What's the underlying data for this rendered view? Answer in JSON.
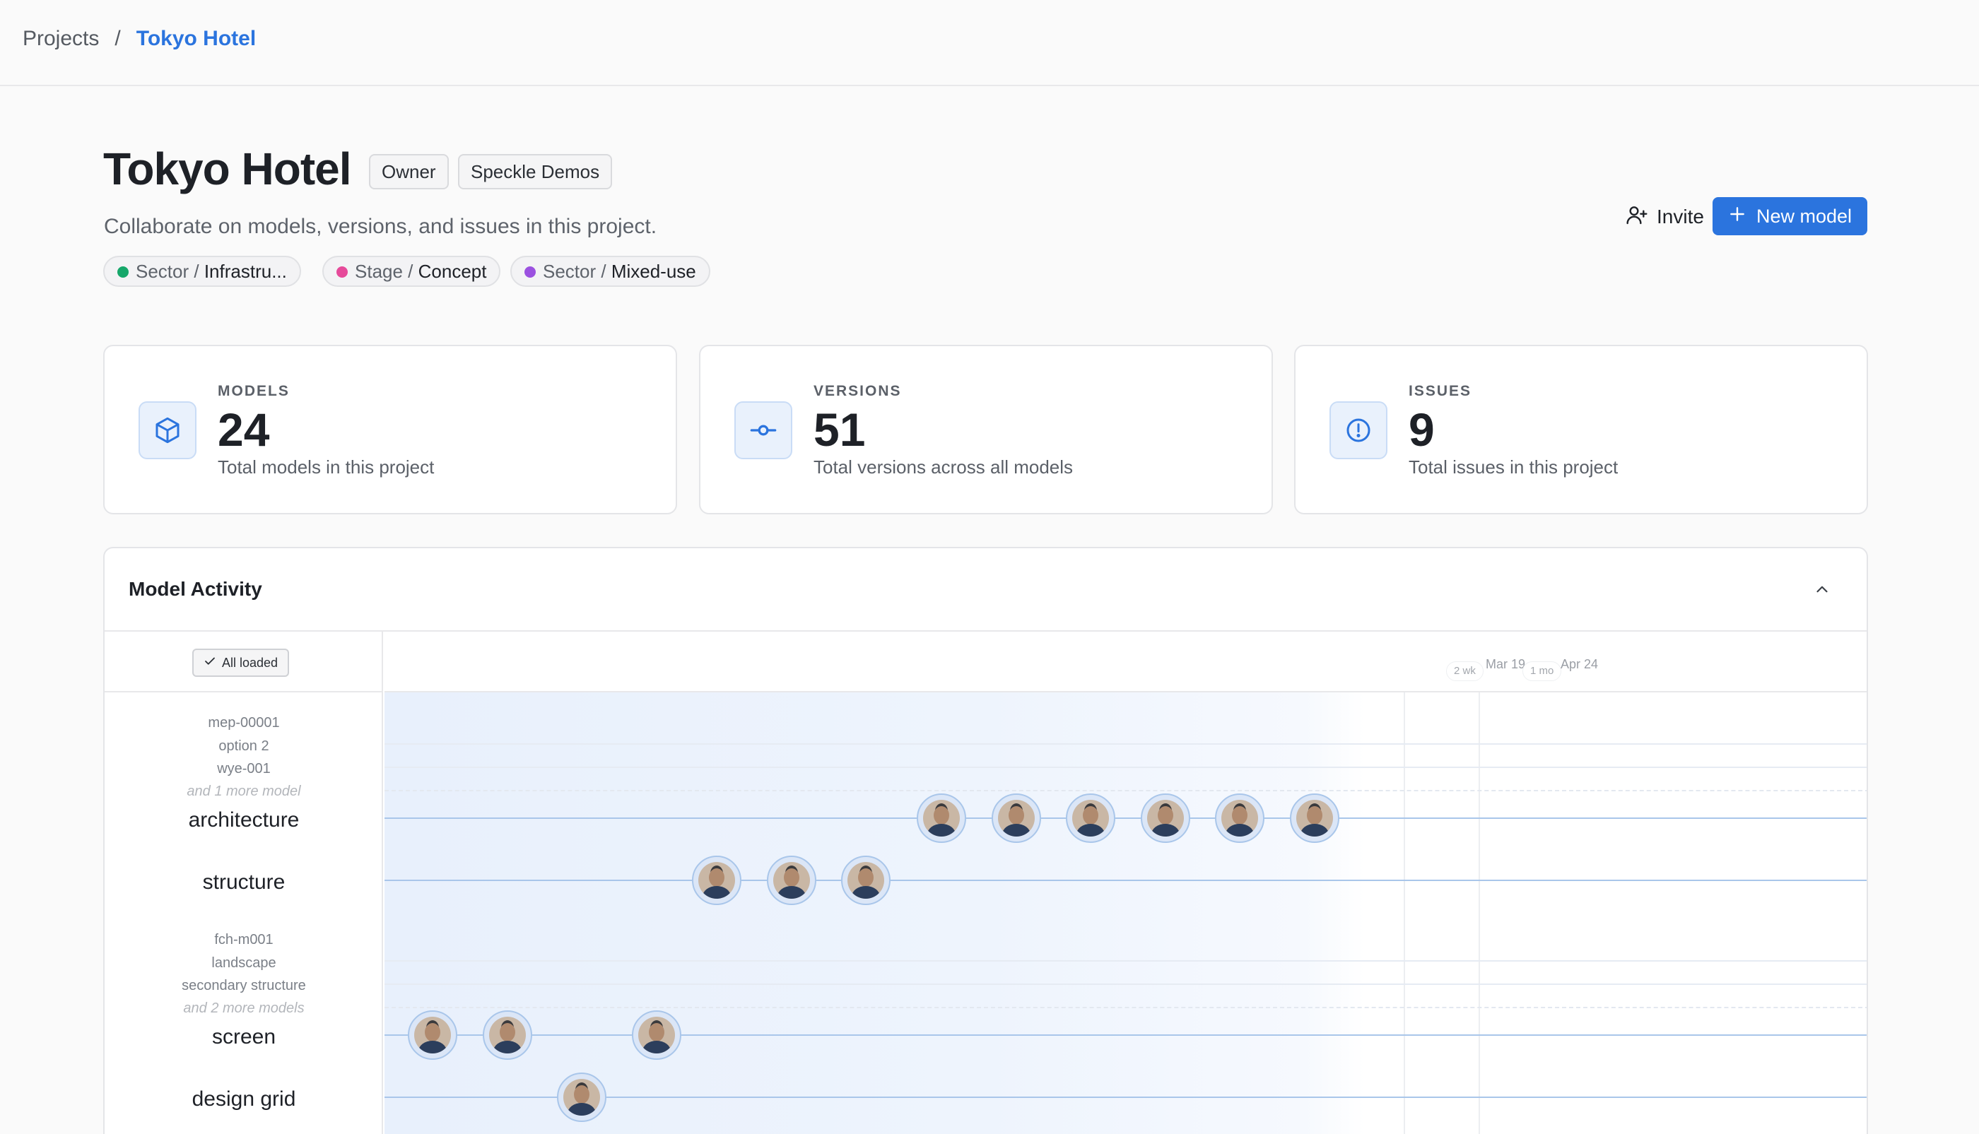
{
  "breadcrumb": {
    "root": "Projects",
    "separator": "/",
    "current": "Tokyo Hotel"
  },
  "project": {
    "title": "Tokyo Hotel",
    "badges": [
      "Owner",
      "Speckle Demos"
    ],
    "description": "Collaborate on models, versions, and issues in this project.",
    "tags": [
      {
        "key": "Sector",
        "sep": " / ",
        "value": "Infrastru...",
        "color": "#16a76a"
      },
      {
        "key": "Stage",
        "sep": " / ",
        "value": "Concept",
        "color": "#e64a9a"
      },
      {
        "key": "Sector",
        "sep": " / ",
        "value": "Mixed-use",
        "color": "#9b51e0"
      }
    ]
  },
  "actions": {
    "invite": "Invite",
    "new_model": "New model"
  },
  "stats": [
    {
      "label": "MODELS",
      "value": "24",
      "desc": "Total models in this project",
      "icon": "cube-icon"
    },
    {
      "label": "VERSIONS",
      "value": "51",
      "desc": "Total versions across all models",
      "icon": "commit-icon"
    },
    {
      "label": "ISSUES",
      "value": "9",
      "desc": "Total issues in this project",
      "icon": "alert-circle-icon"
    }
  ],
  "activity": {
    "title": "Model Activity",
    "loaded_label": "All loaded",
    "axis": {
      "labels": [
        "Mar 19",
        "Apr 24"
      ],
      "chips": [
        "2 wk",
        "1 mo"
      ]
    },
    "groups": [
      {
        "minor": [
          "mep-00001",
          "option 2",
          "wye-001"
        ],
        "more": "and 1 more model",
        "name": "architecture",
        "versions": 6
      },
      {
        "minor": [],
        "more": "",
        "name": "structure",
        "versions": 3
      },
      {
        "minor": [
          "fch-m001",
          "landscape",
          "secondary structure"
        ],
        "more": "and 2 more models",
        "name": "screen",
        "versions": 3
      },
      {
        "minor": [],
        "more": "",
        "name": "design grid",
        "versions": 1
      }
    ]
  }
}
